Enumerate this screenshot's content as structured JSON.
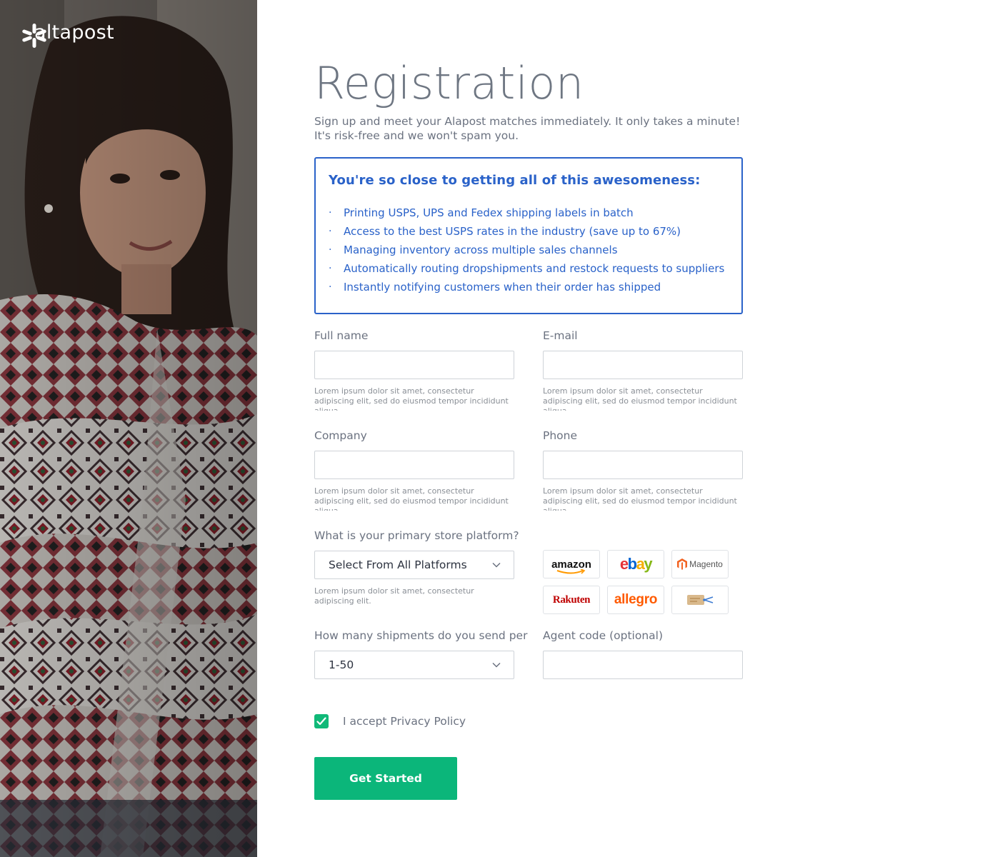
{
  "brand": {
    "name": "altapost"
  },
  "page": {
    "title": "Registration",
    "subtitle_line1": "Sign up and meet your Alapost matches immediately. It only takes a minute!",
    "subtitle_line2": "It's risk-free and we won't spam you."
  },
  "promo": {
    "title": "You're so close to getting all of this awesomeness:",
    "items": [
      "Printing USPS, UPS and Fedex shipping labels in batch",
      "Access to the best USPS rates in the industry (save up to 67%)",
      "Managing inventory across multiple sales channels",
      "Automatically routing dropshipments and restock requests to suppliers",
      "Instantly notifying customers when their order has shipped"
    ]
  },
  "form": {
    "full_name": {
      "label": "Full name",
      "value": "",
      "help": "Lorem ipsum dolor sit amet, consectetur adipiscing elit, sed do eiusmod tempor incididunt aliqua."
    },
    "email": {
      "label": "E-mail",
      "value": "",
      "help": "Lorem ipsum dolor sit amet, consectetur adipiscing elit, sed do eiusmod tempor incididunt aliqua."
    },
    "company": {
      "label": "Company",
      "value": "",
      "help": "Lorem ipsum dolor sit amet, consectetur adipiscing elit, sed do eiusmod tempor incididunt aliqua."
    },
    "phone": {
      "label": "Phone",
      "value": "",
      "help": "Lorem ipsum dolor sit amet, consectetur adipiscing elit, sed do eiusmod tempor incididunt aliqua."
    },
    "platform": {
      "label": "What is your primary store platform?",
      "selected": "Select From All Platforms",
      "help": "Lorem ipsum dolor sit amet, consectetur adipiscing elit."
    },
    "shipments": {
      "label": "How many shipments do you send per",
      "selected": "1-50"
    },
    "agent_code": {
      "label": "Agent code (optional)",
      "value": ""
    },
    "privacy": {
      "label": "I accept Privacy Policy",
      "checked": true
    },
    "submit_label": "Get Started"
  },
  "platforms": [
    {
      "name": "amazon",
      "icon": "amazon-logo"
    },
    {
      "name": "ebay",
      "icon": "ebay-logo"
    },
    {
      "name": "Magento",
      "icon": "magento-logo"
    },
    {
      "name": "Rakuten",
      "icon": "rakuten-logo"
    },
    {
      "name": "allegro",
      "icon": "allegro-logo"
    },
    {
      "name": "",
      "icon": "shipping-tag-logo"
    }
  ],
  "colors": {
    "accent_blue": "#2a62c9",
    "cta_green": "#0bb67a",
    "checkbox_green": "#10b978",
    "text_gray": "#6b7280"
  }
}
